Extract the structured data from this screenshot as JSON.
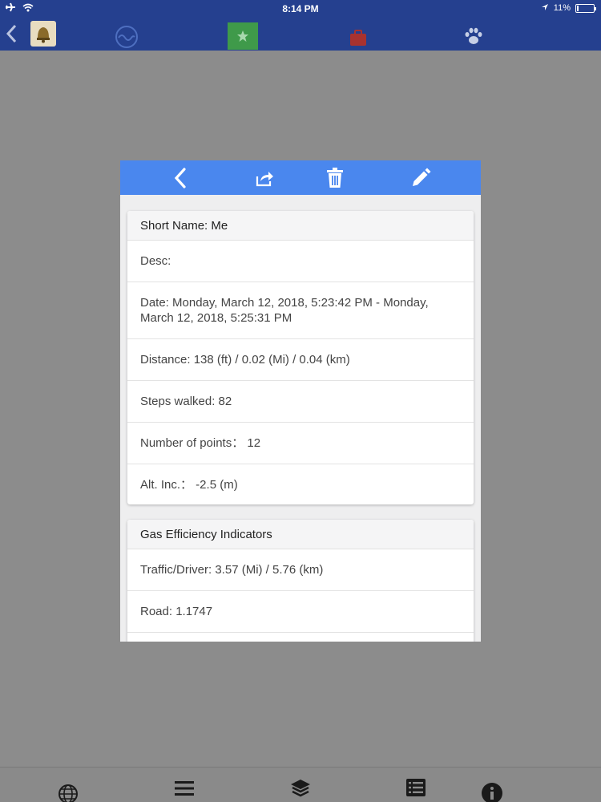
{
  "status": {
    "time": "8:14 PM",
    "battery": "11%",
    "battery_level": 0.11
  },
  "app_bar": {
    "icons": [
      "back-chevron-icon",
      "bell-avatar-icon",
      "wave-icon",
      "star-icon",
      "suitcase-icon",
      "paw-icon"
    ]
  },
  "modal": {
    "header_icons": [
      "back-icon",
      "share-icon",
      "trash-icon",
      "edit-icon"
    ],
    "summary": {
      "title": "Short Name: Me",
      "rows": [
        "Desc:",
        "Date: Monday, March 12, 2018, 5:23:42 PM - Monday, March 12, 2018, 5:25:31 PM",
        "Distance: 138 (ft) / 0.02 (Mi) / 0.04 (km)",
        "Steps walked: 82",
        "Number of points：  12",
        "Alt. Inc.：  -2.5 (m)"
      ]
    },
    "gas": {
      "title": "Gas Efficiency Indicators",
      "rows": [
        "Traffic/Driver: 3.57 (Mi)  / 5.76 (km)",
        "Road: 1.1747"
      ]
    }
  },
  "bottom_bar": {
    "icons": [
      "globe-icon",
      "menu-icon",
      "layers-icon",
      "list-icon",
      "info-icon"
    ]
  },
  "colors": {
    "topbar": "#25408f",
    "modal_header": "#4a87ee",
    "backdrop": "#8c8c8c",
    "star_tab": "#3f9a4a",
    "suitcase": "#a8322f"
  }
}
